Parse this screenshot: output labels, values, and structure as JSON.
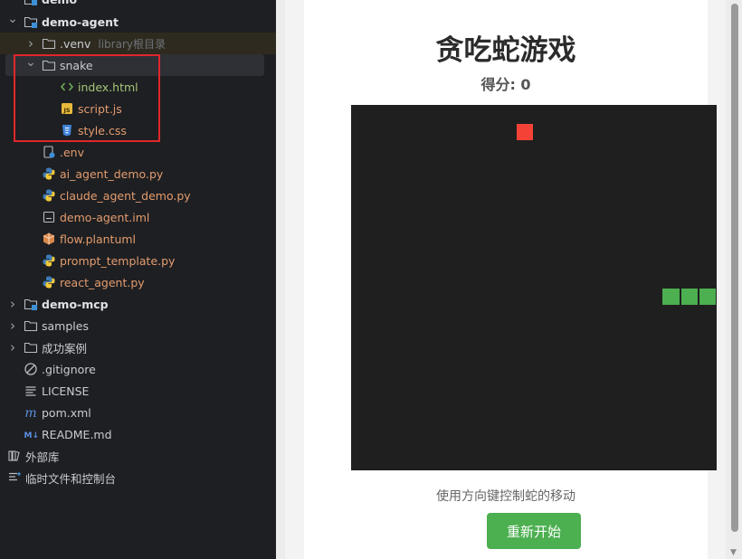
{
  "tree": {
    "items": [
      {
        "label": "demo",
        "indent": 0,
        "arrow": "down",
        "icon": "module-folder",
        "style": "bold"
      },
      {
        "label": "demo-agent",
        "indent": 0,
        "arrow": "down",
        "icon": "module-folder",
        "style": "bold"
      },
      {
        "label": ".venv",
        "indent": 1,
        "arrow": "right",
        "icon": "folder",
        "style": "normal",
        "hint": "library根目录",
        "highlight": "venv"
      },
      {
        "label": "snake",
        "indent": 1,
        "arrow": "down",
        "icon": "folder",
        "style": "normal",
        "highlight": "selected"
      },
      {
        "label": "index.html",
        "indent": 2,
        "arrow": "",
        "icon": "html",
        "style": "green"
      },
      {
        "label": "script.js",
        "indent": 2,
        "arrow": "",
        "icon": "js",
        "style": "orange"
      },
      {
        "label": "style.css",
        "indent": 2,
        "arrow": "",
        "icon": "css",
        "style": "orange"
      },
      {
        "label": ".env",
        "indent": 1,
        "arrow": "",
        "icon": "env",
        "style": "orange"
      },
      {
        "label": "ai_agent_demo.py",
        "indent": 1,
        "arrow": "",
        "icon": "python",
        "style": "orange"
      },
      {
        "label": "claude_agent_demo.py",
        "indent": 1,
        "arrow": "",
        "icon": "python",
        "style": "orange"
      },
      {
        "label": "demo-agent.iml",
        "indent": 1,
        "arrow": "",
        "icon": "iml",
        "style": "orange"
      },
      {
        "label": "flow.plantuml",
        "indent": 1,
        "arrow": "",
        "icon": "plantuml",
        "style": "orange"
      },
      {
        "label": "prompt_template.py",
        "indent": 1,
        "arrow": "",
        "icon": "python",
        "style": "orange"
      },
      {
        "label": "react_agent.py",
        "indent": 1,
        "arrow": "",
        "icon": "python",
        "style": "orange"
      },
      {
        "label": "demo-mcp",
        "indent": 0,
        "arrow": "right",
        "icon": "module-folder",
        "style": "bold"
      },
      {
        "label": "samples",
        "indent": 0,
        "arrow": "right",
        "icon": "folder",
        "style": "normal"
      },
      {
        "label": "成功案例",
        "indent": 0,
        "arrow": "right",
        "icon": "folder",
        "style": "normal"
      },
      {
        "label": ".gitignore",
        "indent": 0,
        "arrow": "",
        "icon": "ignore",
        "style": "normal"
      },
      {
        "label": "LICENSE",
        "indent": 0,
        "arrow": "",
        "icon": "text",
        "style": "normal"
      },
      {
        "label": "pom.xml",
        "indent": 0,
        "arrow": "",
        "icon": "maven",
        "style": "normal"
      },
      {
        "label": "README.md",
        "indent": 0,
        "arrow": "",
        "icon": "markdown",
        "style": "normal"
      },
      {
        "label": "外部库",
        "indent": -1,
        "arrow": "",
        "icon": "library",
        "style": "normal"
      },
      {
        "label": "临时文件和控制台",
        "indent": -1,
        "arrow": "",
        "icon": "scratch",
        "style": "normal"
      }
    ]
  },
  "game": {
    "title": "贪吃蛇游戏",
    "score": "得分: 0",
    "instructions": "使用方向键控制蛇的移动",
    "restart_label": "重新开始",
    "grid_size": 20,
    "food": {
      "col": 9,
      "row": 1,
      "color": "#f44336"
    },
    "snake": {
      "color": "#4caf50",
      "cells": [
        {
          "col": 17,
          "row": 10
        },
        {
          "col": 18,
          "row": 10
        },
        {
          "col": 19,
          "row": 10
        }
      ]
    },
    "board_color": "#1f1f1f"
  }
}
